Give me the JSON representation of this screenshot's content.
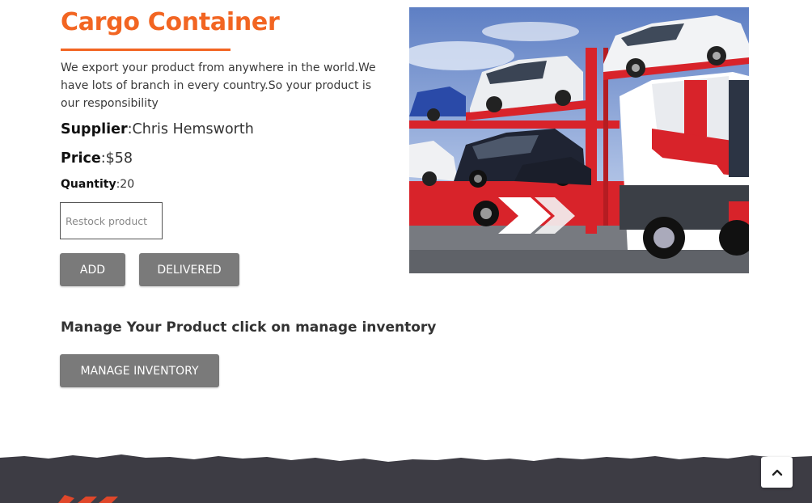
{
  "product": {
    "title": "Cargo Container",
    "description": "We export your product from anywhere in the world.We have lots of branch in every country.So your product is our responsibility",
    "supplier_label": "Supplier",
    "supplier_value": ":Chris Hemsworth",
    "price_label": "Price",
    "price_value": ":$58",
    "quantity_label": "Quantity",
    "quantity_value": ":20"
  },
  "restock": {
    "placeholder": "Restock product"
  },
  "buttons": {
    "add": "ADD",
    "delivered": "DELIVERED",
    "manage_inventory": "MANAGE INVENTORY"
  },
  "manage_text": "Manage Your Product click on manage inventory",
  "colors": {
    "accent": "#f26522",
    "button": "#7a7a7a",
    "footer": "#3d3c44"
  },
  "icons": {
    "scroll_top": "chevron-up-icon",
    "footer_logo": "logo-icon"
  }
}
